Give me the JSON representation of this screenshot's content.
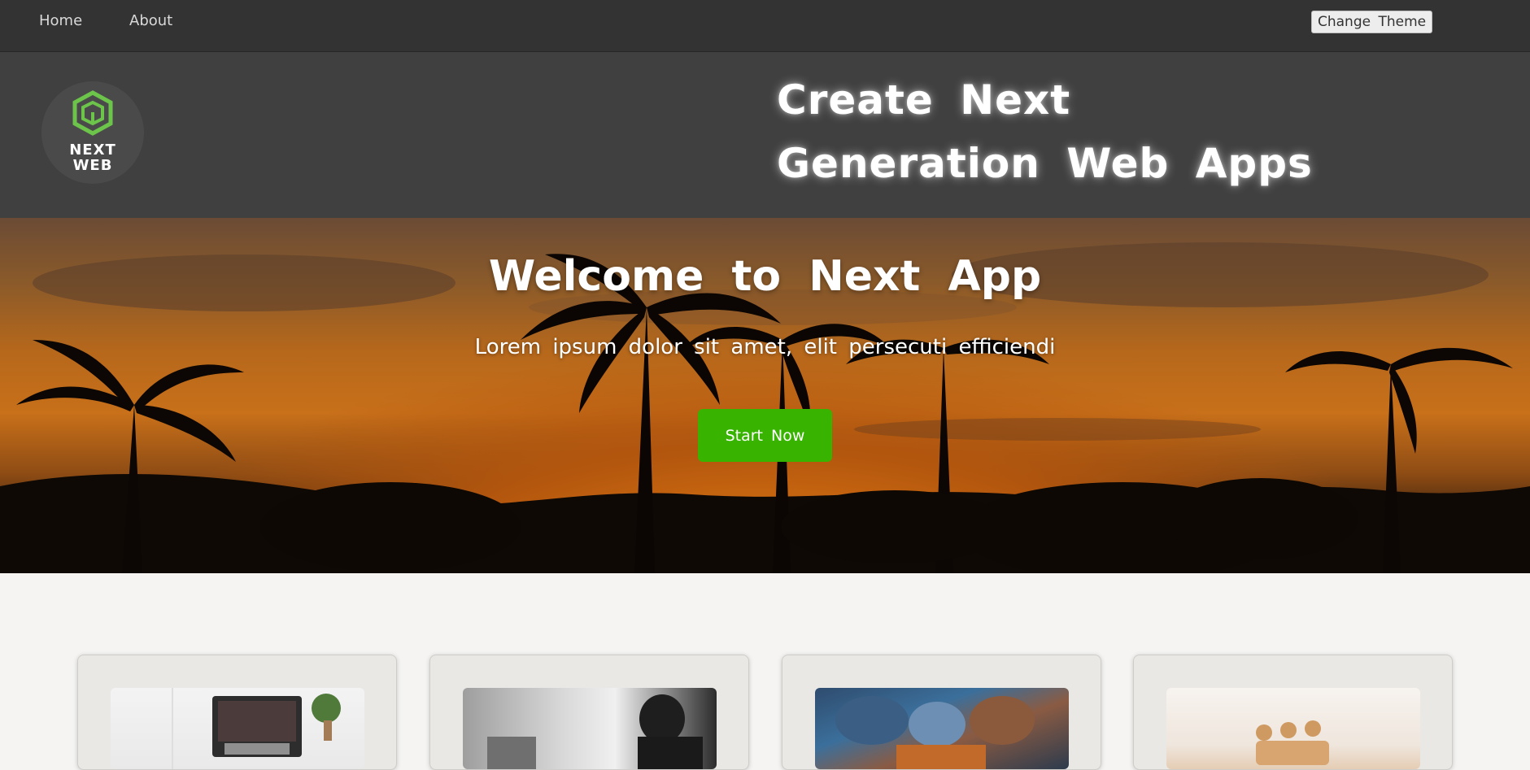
{
  "nav": {
    "home": "Home",
    "about": "About",
    "change_theme": "Change Theme"
  },
  "header": {
    "logo_line1": "NEXT",
    "logo_line2": "WEB",
    "headline_line1": "Create Next",
    "headline_line2": "Generation Web Apps"
  },
  "hero": {
    "title": "Welcome to Next App",
    "subtitle": "Lorem ipsum dolor sit amet, elit persecuti efficiendi",
    "cta": "Start Now"
  },
  "colors": {
    "nav_bg": "#333333",
    "header_bg": "#404040",
    "cta_green": "#37b300",
    "logo_green": "#6cc44a",
    "page_bg": "#f5f4f2"
  },
  "cards": [
    {
      "image": "laptop-desk-photo"
    },
    {
      "image": "person-at-computer-photo"
    },
    {
      "image": "team-hands-photo"
    },
    {
      "image": "wooden-figures-photo"
    }
  ]
}
